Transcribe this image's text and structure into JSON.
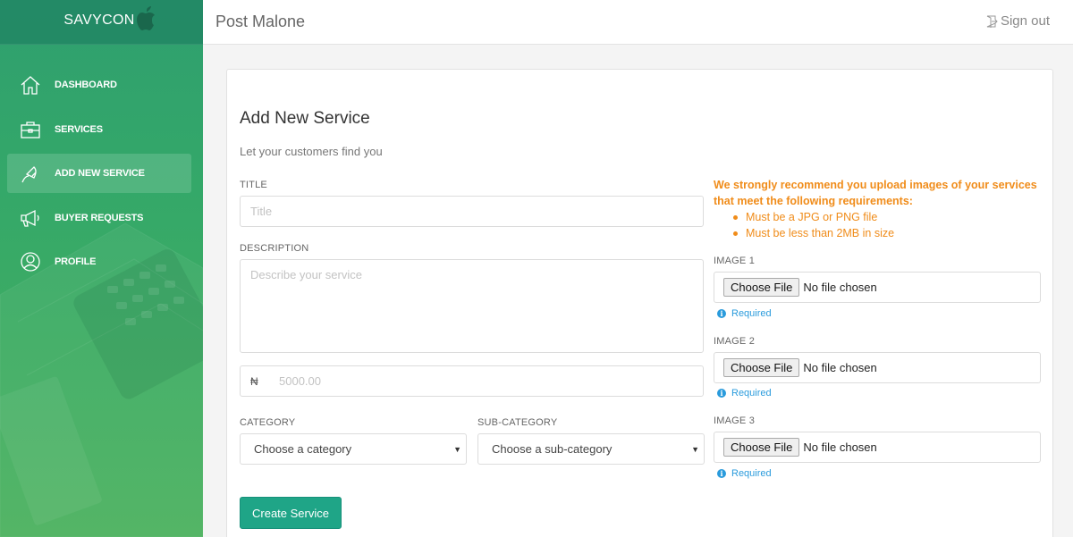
{
  "app": {
    "brand": "SAVYCON"
  },
  "sidebar": {
    "items": [
      {
        "label": "DASHBOARD",
        "icon": "home-icon",
        "active": false
      },
      {
        "label": "SERVICES",
        "icon": "briefcase-icon",
        "active": false
      },
      {
        "label": "ADD NEW SERVICE",
        "icon": "plug-icon",
        "active": true
      },
      {
        "label": "BUYER REQUESTS",
        "icon": "megaphone-icon",
        "active": false
      },
      {
        "label": "PROFILE",
        "icon": "user-circle-icon",
        "active": false
      }
    ]
  },
  "header": {
    "user_name": "Post Malone",
    "signout_label": "Sign out",
    "signout_icon": "signout-icon"
  },
  "form": {
    "title": "Add New Service",
    "subtitle": "Let your customers find you",
    "title_label": "TITLE",
    "title_placeholder": "Title",
    "description_label": "DESCRIPTION",
    "description_placeholder": "Describe your service",
    "currency_symbol": "₦",
    "price_placeholder": "5000.00",
    "category_label": "CATEGORY",
    "category_value": "Choose a category",
    "subcategory_label": "SUB-CATEGORY",
    "subcategory_value": "Choose a sub-category",
    "submit_label": "Create Service"
  },
  "images": {
    "recommendation": "We strongly recommend you upload images of your services that meet the following requirements:",
    "requirements": [
      "Must be a JPG or PNG file",
      "Must be less than 2MB in size"
    ],
    "slots": [
      {
        "label": "IMAGE 1",
        "button": "Choose File",
        "status": "No file chosen",
        "required": "Required"
      },
      {
        "label": "IMAGE 2",
        "button": "Choose File",
        "status": "No file chosen",
        "required": "Required"
      },
      {
        "label": "IMAGE 3",
        "button": "Choose File",
        "status": "No file chosen",
        "required": "Required"
      }
    ]
  },
  "colors": {
    "sidebar_green": "#34a869",
    "accent_teal": "#1fa587",
    "warning_orange": "#f08c1a",
    "info_blue": "#2a9bdc"
  }
}
